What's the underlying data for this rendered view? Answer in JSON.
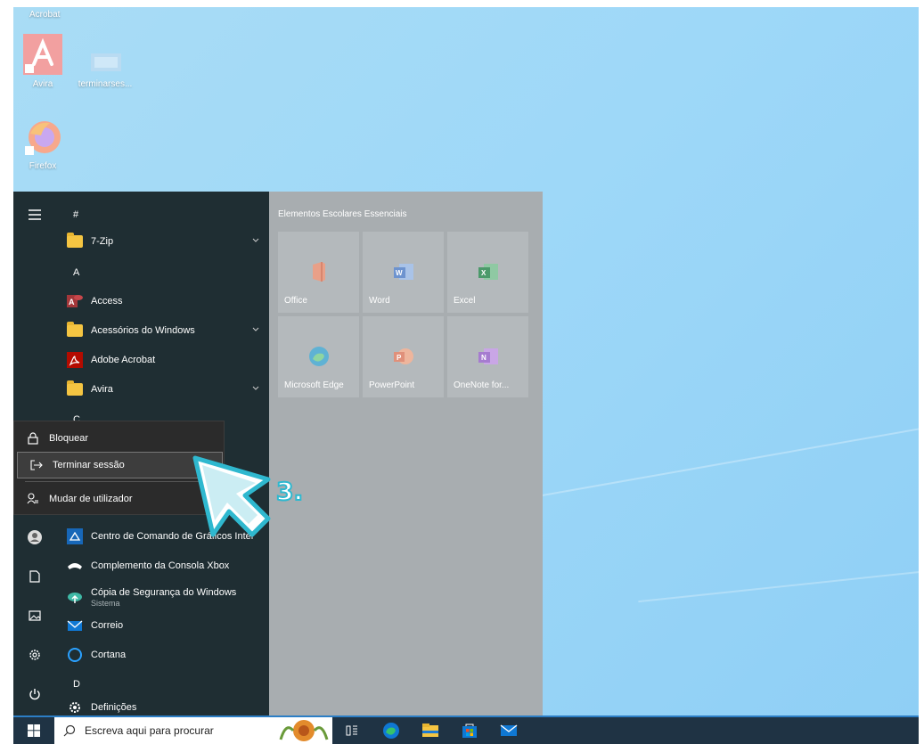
{
  "desktop": {
    "top_label": "Acrobat",
    "icons": [
      {
        "label": "Avira",
        "icon": "avira-icon"
      },
      {
        "label": "terminarses...",
        "icon": "shortcut-icon"
      },
      {
        "label": "Firefox",
        "icon": "firefox-icon"
      }
    ]
  },
  "start_menu": {
    "apps": [
      {
        "type": "letter",
        "label": "#"
      },
      {
        "type": "app",
        "label": "7-Zip",
        "icon": "folder-icon",
        "expandable": true
      },
      {
        "type": "letter",
        "label": "A"
      },
      {
        "type": "app",
        "label": "Access",
        "icon": "access-icon"
      },
      {
        "type": "app",
        "label": "Acessórios do Windows",
        "icon": "folder-icon",
        "expandable": true
      },
      {
        "type": "app",
        "label": "Adobe Acrobat",
        "icon": "acrobat-icon"
      },
      {
        "type": "app",
        "label": "Avira",
        "icon": "folder-icon",
        "expandable": true
      },
      {
        "type": "letter",
        "label": "C"
      },
      {
        "type": "app",
        "label": "Centro de Comando de Gráficos Intel",
        "icon": "intel-graphics-icon"
      },
      {
        "type": "app",
        "label": "Complemento da Consola Xbox",
        "icon": "xbox-icon"
      },
      {
        "type": "app",
        "label": "Cópia de Segurança do Windows",
        "sub": "Sistema",
        "icon": "backup-icon"
      },
      {
        "type": "app",
        "label": "Correio",
        "icon": "mail-icon"
      },
      {
        "type": "app",
        "label": "Cortana",
        "icon": "cortana-icon"
      },
      {
        "type": "letter",
        "label": "D"
      },
      {
        "type": "app",
        "label": "Definições",
        "icon": "settings-icon"
      }
    ],
    "tiles_group_title": "Elementos Escolares Essenciais",
    "tiles": [
      {
        "label": "Office",
        "icon": "office-icon"
      },
      {
        "label": "Word",
        "icon": "word-icon"
      },
      {
        "label": "Excel",
        "icon": "excel-icon"
      },
      {
        "label": "Microsoft Edge",
        "icon": "edge-icon"
      },
      {
        "label": "PowerPoint",
        "icon": "powerpoint-icon"
      },
      {
        "label": "OneNote for...",
        "icon": "onenote-icon"
      }
    ]
  },
  "power_popup": {
    "lock": "Bloquear",
    "sign_out": "Terminar sessão",
    "switch_user": "Mudar de utilizador"
  },
  "annotation": {
    "step": "3."
  },
  "taskbar": {
    "search_placeholder": "Escreva aqui para procurar"
  },
  "colors": {
    "menu_bg": "#1f2e33",
    "tiles_bg": "#a8adb0",
    "taskbar_bg": "#1f3344",
    "accent": "#2fb8cf"
  }
}
